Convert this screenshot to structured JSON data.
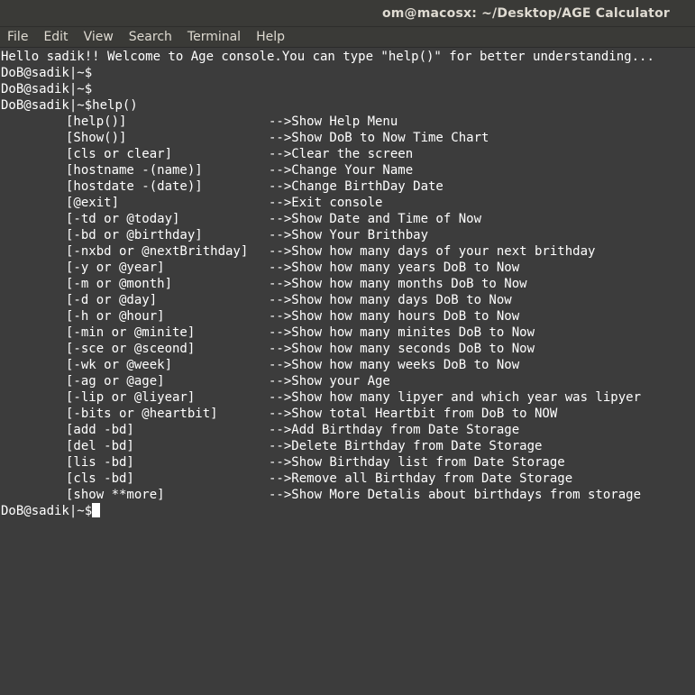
{
  "window": {
    "title": "om@macosx: ~/Desktop/AGE Calculator"
  },
  "menubar": {
    "items": [
      "File",
      "Edit",
      "View",
      "Search",
      "Terminal",
      "Help"
    ]
  },
  "terminal": {
    "welcome": "Hello sadik!! Welcome to Age console.You can type \"help()\" for better understanding...",
    "prompt": "DoB@sadik|~$",
    "help_command": "help()",
    "help_rows": [
      {
        "cmd": "[help()]",
        "desc": "-->Show Help Menu"
      },
      {
        "cmd": "[Show()]",
        "desc": "-->Show DoB to Now Time Chart"
      },
      {
        "cmd": "[cls or clear]",
        "desc": "-->Clear the screen"
      },
      {
        "cmd": "[hostname -(name)]",
        "desc": "-->Change Your Name"
      },
      {
        "cmd": "[hostdate -(date)]",
        "desc": "-->Change BirthDay Date"
      },
      {
        "cmd": "[@exit]",
        "desc": "-->Exit console"
      },
      {
        "cmd": "[-td or @today]",
        "desc": "-->Show Date and Time of Now"
      },
      {
        "cmd": "[-bd or @birthday]",
        "desc": "-->Show Your Brithbay"
      },
      {
        "cmd": "[-nxbd or @nextBrithday]",
        "desc": "-->Show how many days of your next brithday"
      },
      {
        "cmd": "[-y or @year]",
        "desc": "-->Show how many years DoB to Now"
      },
      {
        "cmd": "[-m or @month]",
        "desc": "-->Show how many months DoB to Now"
      },
      {
        "cmd": "[-d or @day]",
        "desc": "-->Show how many days DoB to Now"
      },
      {
        "cmd": "[-h or @hour]",
        "desc": "-->Show how many hours DoB to Now"
      },
      {
        "cmd": "[-min or @minite]",
        "desc": "-->Show how many minites DoB to Now"
      },
      {
        "cmd": "[-sce or @sceond]",
        "desc": "-->Show how many seconds DoB to Now"
      },
      {
        "cmd": "[-wk or @week]",
        "desc": "-->Show how many weeks DoB to Now"
      },
      {
        "cmd": "[-ag or @age]",
        "desc": "-->Show your Age"
      },
      {
        "cmd": "[-lip or @liyear]",
        "desc": "-->Show how many lipyer and which year was lipyer"
      },
      {
        "cmd": "[-bits or @heartbit]",
        "desc": "-->Show total Heartbit from DoB to NOW"
      },
      {
        "cmd": "[add -bd]",
        "desc": "-->Add Birthday from Date Storage"
      },
      {
        "cmd": "[del -bd]",
        "desc": "-->Delete Birthday from Date Storage"
      },
      {
        "cmd": "[lis -bd]",
        "desc": "-->Show Birthday list from Date Storage"
      },
      {
        "cmd": "[cls -bd]",
        "desc": "-->Remove all Birthday from Date Storage"
      },
      {
        "cmd": "[show **more]",
        "desc": "-->Show More Detalis about birthdays from storage"
      }
    ]
  }
}
